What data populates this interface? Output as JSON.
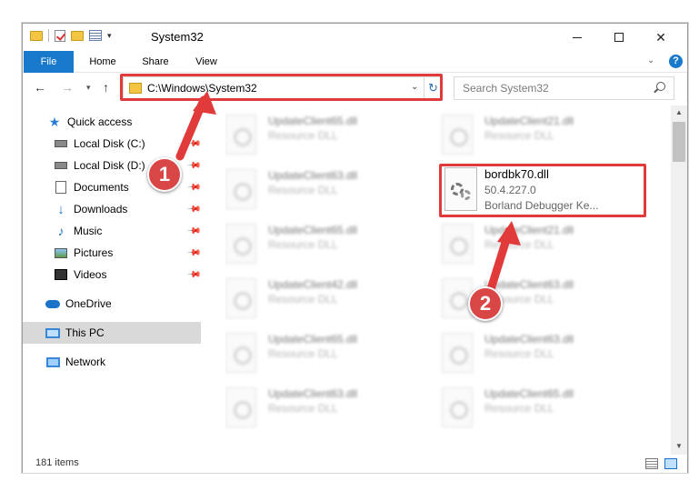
{
  "window": {
    "title": "System32"
  },
  "ribbon": {
    "tabs": [
      "File",
      "Home",
      "Share",
      "View"
    ],
    "help": "?"
  },
  "address": {
    "path": "C:\\Windows\\System32",
    "search_placeholder": "Search System32"
  },
  "sidebar": {
    "items": [
      {
        "label": "Quick access",
        "icon": "star-icon"
      },
      {
        "label": "Local Disk (C:)",
        "icon": "drive-icon",
        "pinned": true
      },
      {
        "label": "Local Disk (D:)",
        "icon": "drive-icon",
        "pinned": true
      },
      {
        "label": "Documents",
        "icon": "documents-icon",
        "pinned": true
      },
      {
        "label": "Downloads",
        "icon": "downloads-icon",
        "pinned": true
      },
      {
        "label": "Music",
        "icon": "music-icon",
        "pinned": true
      },
      {
        "label": "Pictures",
        "icon": "pictures-icon",
        "pinned": true
      },
      {
        "label": "Videos",
        "icon": "videos-icon",
        "pinned": true
      },
      {
        "label": "OneDrive",
        "icon": "onedrive-icon"
      },
      {
        "label": "This PC",
        "icon": "this-pc-icon",
        "selected": true
      },
      {
        "label": "Network",
        "icon": "network-icon"
      }
    ]
  },
  "files": {
    "col1": [
      {
        "name": "UpdateClient65.dll",
        "type": "Resource DLL"
      },
      {
        "name": "UpdateClient63.dll",
        "type": "Resource DLL"
      },
      {
        "name": "UpdateClient65.dll",
        "type": "Resource DLL"
      },
      {
        "name": "UpdateClient42.dll",
        "type": "Resource DLL"
      },
      {
        "name": "UpdateClient65.dll",
        "type": "Resource DLL"
      },
      {
        "name": "UpdateClient63.dll",
        "type": "Resource DLL"
      }
    ],
    "col2": [
      {
        "name": "UpdateClient21.dll",
        "type": "Resource DLL"
      },
      {
        "name": "UpdateClient21.dll",
        "type": "Resource DLL"
      },
      {
        "name": "UpdateClient63.dll",
        "type": "Resource DLL"
      },
      {
        "name": "UpdateClient63.dll",
        "type": "Resource DLL"
      },
      {
        "name": "UpdateClient65.dll",
        "type": "Resource DLL"
      }
    ],
    "highlighted": {
      "name": "bordbk70.dll",
      "version": "50.4.227.0",
      "description": "Borland Debugger Ke..."
    }
  },
  "status": {
    "count": "181 items"
  },
  "annotations": {
    "step1": "1",
    "step2": "2",
    "color": "#e03a3a"
  }
}
